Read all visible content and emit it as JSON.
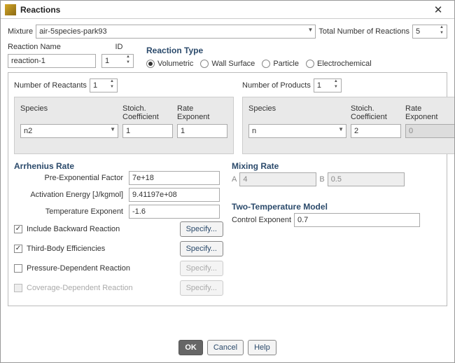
{
  "window": {
    "title": "Reactions"
  },
  "top": {
    "mixture_label": "Mixture",
    "mixture": "air-5species-park93",
    "total_label": "Total Number of Reactions",
    "total": "5"
  },
  "name_row": {
    "name_label": "Reaction Name",
    "name": "reaction-1",
    "id_label": "ID",
    "id": "1",
    "type_label": "Reaction Type",
    "options": {
      "volumetric": "Volumetric",
      "wall": "Wall Surface",
      "particle": "Particle",
      "electro": "Electrochemical"
    }
  },
  "reactants": {
    "count_label": "Number of Reactants",
    "count": "1",
    "h_species": "Species",
    "h_stoich": "Stoich.\nCoefficient",
    "h_rate": "Rate\nExponent",
    "species": "n2",
    "stoich": "1",
    "rate": "1"
  },
  "products": {
    "count_label": "Number of Products",
    "count": "1",
    "h_species": "Species",
    "h_stoich": "Stoich.\nCoefficient",
    "h_rate": "Rate\nExponent",
    "species": "n",
    "stoich": "2",
    "rate": "0"
  },
  "arrhenius": {
    "title": "Arrhenius Rate",
    "pre_label": "Pre-Exponential Factor",
    "pre": "7e+18",
    "ae_label": "Activation Energy [J/kgmol]",
    "ae": "9.41197e+08",
    "te_label": "Temperature Exponent",
    "te": "-1.6",
    "chk_backward": "Include Backward Reaction",
    "chk_thirdbody": "Third-Body Efficiencies",
    "chk_pressure": "Pressure-Dependent Reaction",
    "chk_coverage": "Coverage-Dependent Reaction",
    "specify": "Specify..."
  },
  "mixing": {
    "title": "Mixing Rate",
    "a_label": "A",
    "a": "4",
    "b_label": "B",
    "b": "0.5"
  },
  "twotemp": {
    "title": "Two-Temperature Model",
    "ce_label": "Control Exponent",
    "ce": "0.7"
  },
  "footer": {
    "ok": "OK",
    "cancel": "Cancel",
    "help": "Help"
  }
}
